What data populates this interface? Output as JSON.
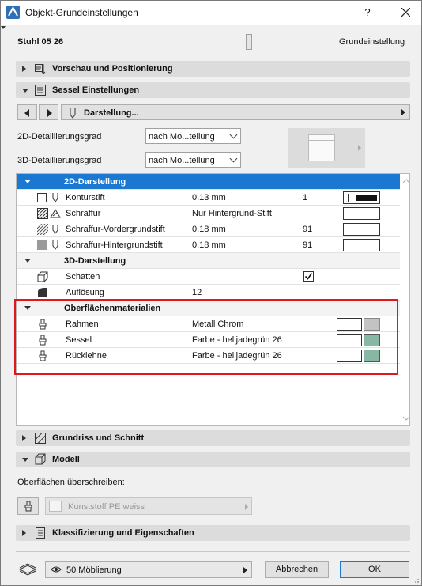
{
  "window": {
    "title": "Objekt-Grundeinstellungen",
    "help_label": "?",
    "close_label": "X"
  },
  "header": {
    "object_name": "Stuhl 05 26",
    "mode_label": "Grundeinstellung"
  },
  "sections": {
    "preview": "Vorschau und Positionierung",
    "sessel": "Sessel Einstellungen",
    "grundriss": "Grundriss und Schnitt",
    "modell": "Modell",
    "klassifizierung": "Klassifizierung und Eigenschaften"
  },
  "nav": {
    "prev_icon": "arrow-left-icon",
    "next_icon": "arrow-right-icon",
    "page_label": "Darstellung...",
    "more_icon": "triangle-right-icon"
  },
  "detail": {
    "label_2d": "2D-Detaillierungsgrad",
    "value_2d": "nach Mo...tellung",
    "label_3d": "3D-Detaillierungsgrad",
    "value_3d": "nach Mo...tellung"
  },
  "table": {
    "groups": {
      "g2d": "2D-Darstellung",
      "g3d": "3D-Darstellung",
      "gmat": "Oberflächenmaterialien"
    },
    "rows": [
      {
        "name": "Konturstift",
        "value": "0.13 mm",
        "num": "1"
      },
      {
        "name": "Schraffur",
        "value": "Nur Hintergrund-Stift",
        "num": ""
      },
      {
        "name": "Schraffur-Vordergrundstift",
        "value": "0.18 mm",
        "num": "91"
      },
      {
        "name": "Schraffur-Hintergrundstift",
        "value": "0.18 mm",
        "num": "91"
      },
      {
        "name": "Schatten",
        "value": "",
        "num": ""
      },
      {
        "name": "Auflösung",
        "value": "12",
        "num": ""
      },
      {
        "name": "Rahmen",
        "value": "Metall Chrom",
        "num": ""
      },
      {
        "name": "Sessel",
        "value": "Farbe - helljadegrün 26",
        "num": ""
      },
      {
        "name": "Rücklehne",
        "value": "Farbe - helljadegrün 26",
        "num": ""
      }
    ],
    "schatten_checked": true,
    "colors": {
      "chrome": "#c3c3c3",
      "jade": "#86b8a4",
      "selection": "#1b78d2",
      "highlight_box": "#e0181d"
    }
  },
  "override": {
    "label": "Oberflächen überschreiben:",
    "material": "Kunststoff PE weiss"
  },
  "footer": {
    "layer": "50 Möblierung",
    "cancel": "Abbrechen",
    "ok": "OK"
  }
}
